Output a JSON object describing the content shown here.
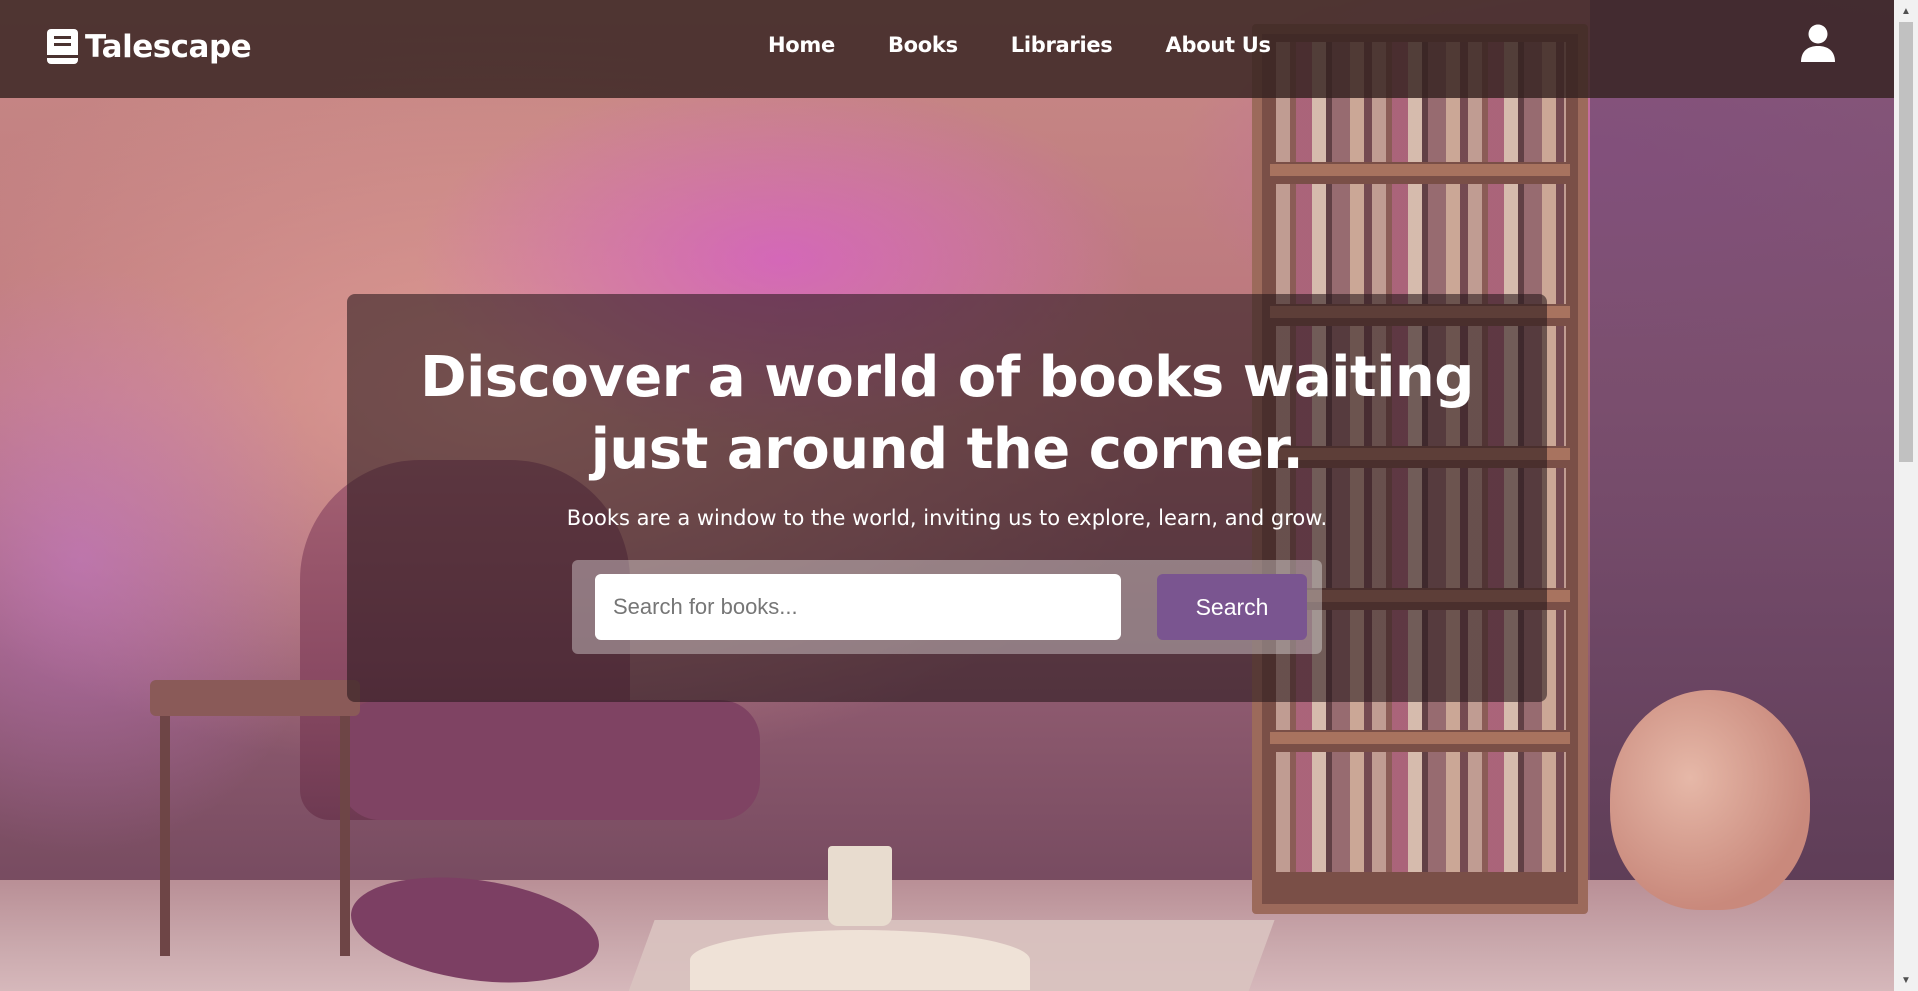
{
  "brand": {
    "name": "Talescape",
    "icon": "book-icon"
  },
  "nav": {
    "items": [
      {
        "label": "Home"
      },
      {
        "label": "Books"
      },
      {
        "label": "Libraries"
      },
      {
        "label": "About Us"
      }
    ],
    "account_icon": "user-icon"
  },
  "hero": {
    "title": "Discover a world of books waiting just around the corner.",
    "subtitle": "Books are a window to the world, inviting us to explore, learn, and grow.",
    "search": {
      "placeholder": "Search for books...",
      "value": "",
      "button_label": "Search"
    }
  },
  "colors": {
    "navbar_bg": "#342220",
    "accent": "#7a5590",
    "text": "#ffffff"
  }
}
